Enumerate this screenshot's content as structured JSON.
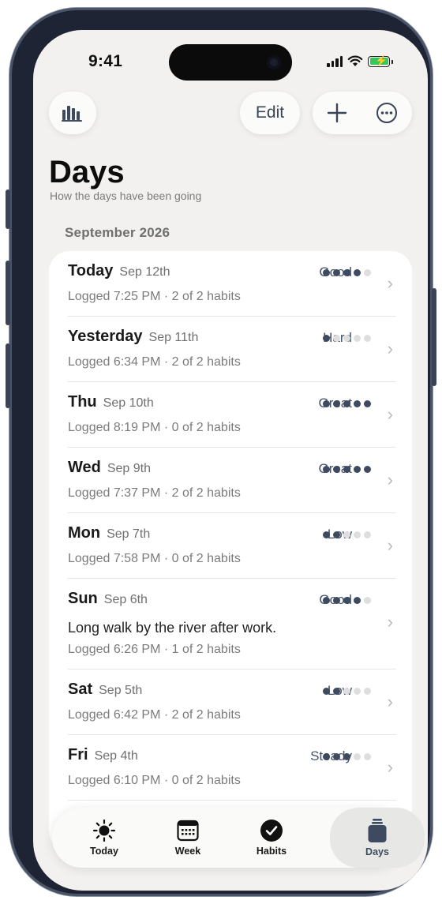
{
  "status_bar": {
    "time": "9:41"
  },
  "toolbar": {
    "edit_label": "Edit"
  },
  "header": {
    "title": "Days",
    "subtitle": "How the days have been going"
  },
  "section": {
    "month": "September 2026"
  },
  "colors": {
    "accent": "#3e4a5f",
    "background": "#f2f1ef",
    "battery": "#34c759"
  },
  "days": [
    {
      "day": "Today",
      "date": "Sep 12th",
      "mood": "Good",
      "rating": 4,
      "note": "",
      "meta": "Logged 7:25 PM · 2 of 2 habits"
    },
    {
      "day": "Yesterday",
      "date": "Sep 11th",
      "mood": "Hard",
      "rating": 1,
      "note": "",
      "meta": "Logged 6:34 PM · 2 of 2 habits"
    },
    {
      "day": "Thu",
      "date": "Sep 10th",
      "mood": "Great",
      "rating": 5,
      "note": "",
      "meta": "Logged 8:19 PM · 0 of 2 habits"
    },
    {
      "day": "Wed",
      "date": "Sep 9th",
      "mood": "Great",
      "rating": 5,
      "note": "",
      "meta": "Logged 7:37 PM · 2 of 2 habits"
    },
    {
      "day": "Mon",
      "date": "Sep 7th",
      "mood": "Low",
      "rating": 2,
      "note": "",
      "meta": "Logged 7:58 PM · 0 of 2 habits"
    },
    {
      "day": "Sun",
      "date": "Sep 6th",
      "mood": "Good",
      "rating": 4,
      "note": "Long walk by the river after work.",
      "meta": "Logged 6:26 PM · 1 of 2 habits"
    },
    {
      "day": "Sat",
      "date": "Sep 5th",
      "mood": "Low",
      "rating": 2,
      "note": "",
      "meta": "Logged 6:42 PM · 2 of 2 habits"
    },
    {
      "day": "Fri",
      "date": "Sep 4th",
      "mood": "Steady",
      "rating": 3,
      "note": "",
      "meta": "Logged 6:10 PM · 0 of 2 habits"
    }
  ],
  "tabs": [
    {
      "label": "Today",
      "icon": "sun-icon",
      "active": false
    },
    {
      "label": "Week",
      "icon": "calendar-grid-icon",
      "active": false
    },
    {
      "label": "Habits",
      "icon": "checkmark-circle-icon",
      "active": false
    },
    {
      "label": "Days",
      "icon": "jar-icon",
      "active": true
    }
  ]
}
